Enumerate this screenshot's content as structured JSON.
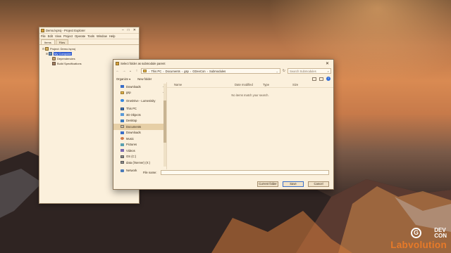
{
  "project_explorer": {
    "title": "Demo.lvproj - Project Explorer",
    "window_controls": [
      "–",
      "□",
      "✕"
    ],
    "menu": [
      "File",
      "Edit",
      "View",
      "Project",
      "Operate",
      "Tools",
      "Window",
      "Help"
    ],
    "tabs": [
      "Items",
      "Files"
    ],
    "tree": [
      {
        "label": "Project: Demo.lvproj",
        "expander": "⊟",
        "icon": "project-icon",
        "indent": 0
      },
      {
        "label": "My Computer",
        "expander": "⊞",
        "icon": "computer-icon",
        "indent": 1,
        "selected": true
      },
      {
        "label": "Dependencies",
        "expander": "",
        "icon": "dependencies-icon",
        "indent": 2
      },
      {
        "label": "Build Specifications",
        "expander": "",
        "icon": "build-specs-icon",
        "indent": 2
      }
    ]
  },
  "dialog": {
    "title": "Select folder as submodule parent",
    "close_glyph": "✕",
    "nav_glyphs": {
      "back": "←",
      "forward": "→",
      "up_dropdown": "⌄",
      "up": "↑",
      "refresh": "↻",
      "search": "⌕",
      "separator": "›"
    },
    "breadcrumb": [
      "This PC",
      "Documents",
      "gsp",
      "GDevCon",
      "Submodules"
    ],
    "search_placeholder": "Search Submodules",
    "toolbar": {
      "organize": "Organize ▾",
      "new_folder": "New folder",
      "help": "?"
    },
    "nav_pane": [
      {
        "label": "Downloads",
        "icon": "download-icon",
        "pinned": true
      },
      {
        "label": "gsp",
        "icon": "folder-icon",
        "pinned": true
      },
      {
        "label": "OneDrive - Lumenisity",
        "icon": "onedrive-icon",
        "gap": true
      },
      {
        "label": "This PC",
        "icon": "this-pc-icon",
        "gap": true
      },
      {
        "label": "3D Objects",
        "icon": "3d-objects-icon"
      },
      {
        "label": "Desktop",
        "icon": "desktop-icon"
      },
      {
        "label": "Documents",
        "icon": "documents-icon",
        "selected": true
      },
      {
        "label": "Downloads",
        "icon": "download-icon"
      },
      {
        "label": "Music",
        "icon": "music-icon"
      },
      {
        "label": "Pictures",
        "icon": "pictures-icon"
      },
      {
        "label": "Videos",
        "icon": "videos-icon"
      },
      {
        "label": "OS (C:)",
        "icon": "drive-icon"
      },
      {
        "label": "data (\\\\server) (X:)",
        "icon": "network-drive-icon"
      },
      {
        "label": "Network",
        "icon": "network-icon",
        "gap": true
      }
    ],
    "pin_glyph": "✦",
    "columns": [
      "Name",
      "Date modified",
      "Type",
      "Size"
    ],
    "empty_message": "No items match your search.",
    "file_name_label": "File name:",
    "file_name_value": "",
    "buttons": {
      "current_folder": "Current folder",
      "save": "Save",
      "cancel": "Cancel"
    }
  },
  "watermark": {
    "logo_letter": "G",
    "dev_line1": "DEV",
    "dev_line2": "CON",
    "brand": "Labvolution"
  }
}
